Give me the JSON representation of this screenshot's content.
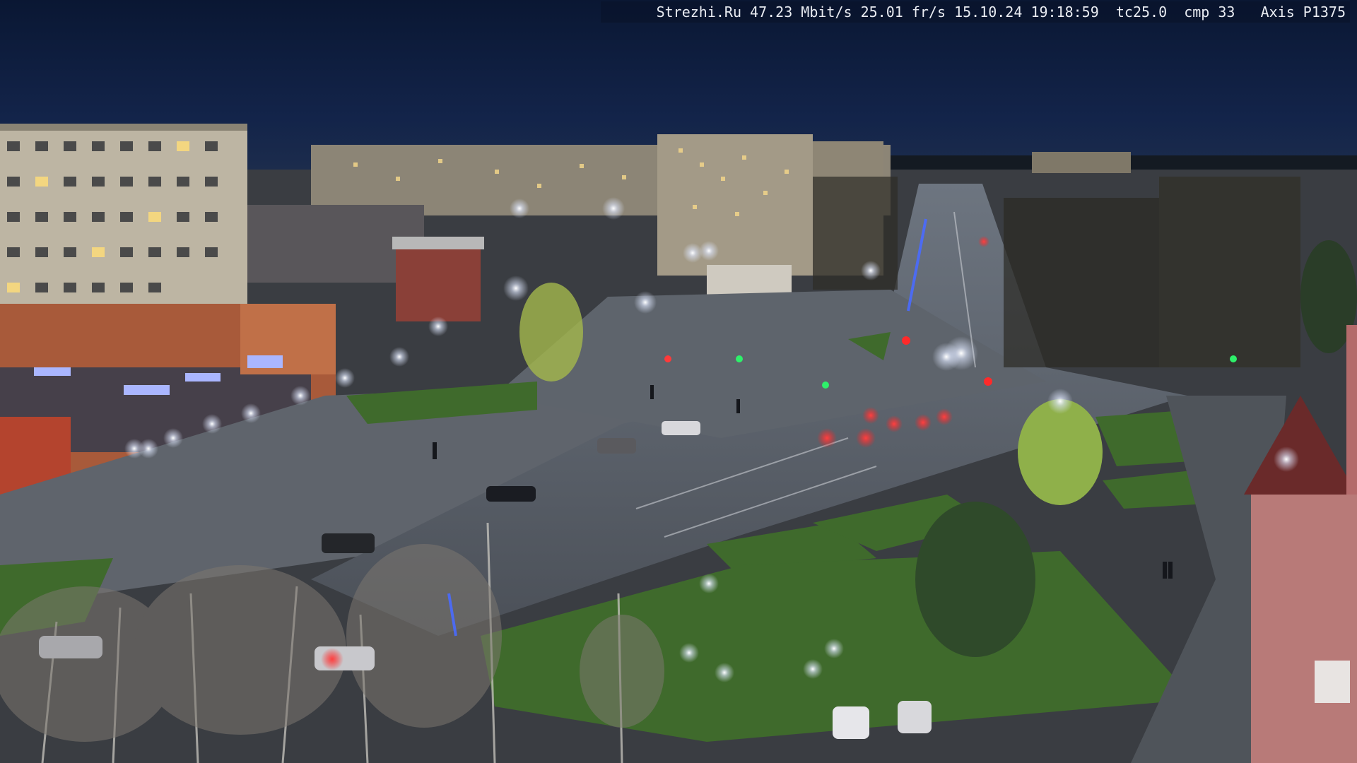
{
  "camera_overlay": {
    "site": "Strezhi.Ru",
    "bitrate": "47.23 Mbit/s",
    "framerate": "25.01 fr/s",
    "date": "15.10.24",
    "time": "19:18:59",
    "tc": "tc25.0",
    "cmp": "cmp 33",
    "model": "Axis P1375"
  },
  "scene": {
    "type": "night-time webcam view of a town square and wide avenue",
    "colors": {
      "sky": "#0c1a3a",
      "horizon": "#1a2a4a",
      "road": "#5a5f66",
      "grass": "#3f6a2c",
      "streetlight": "#f4f7ff",
      "taillight": "#ff2a2a",
      "facade_left": "#c9c1b0",
      "store_sign": "#9aa8ff"
    }
  }
}
